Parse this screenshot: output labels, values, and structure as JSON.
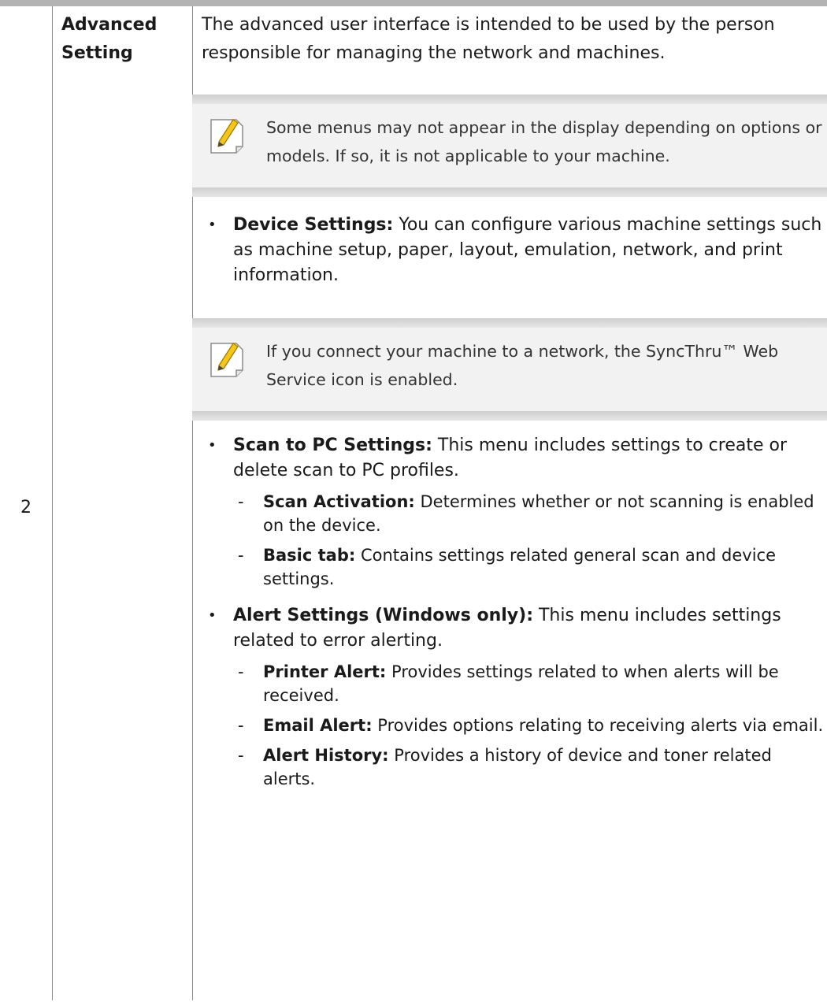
{
  "row_number": "2",
  "label": "Advanced Setting",
  "intro": "The advanced user interface is intended to be used by the person responsible for managing the network and machines.",
  "note1": "Some menus may not appear in the display depending on options or models. If so, it is not applicable to your machine.",
  "device_settings": {
    "title": "Device Settings:",
    "text": " You can configure various machine settings such as machine setup, paper, layout, emulation, network, and print information."
  },
  "note2": "If you connect your machine to a network, the SyncThru™ Web Service icon is enabled.",
  "scan_to_pc": {
    "title": "Scan to PC Settings:",
    "text": " This menu includes settings to create or delete scan to PC profiles.",
    "items": [
      {
        "title": "Scan Activation:",
        "text": " Determines whether or not scanning is enabled on the device."
      },
      {
        "title": "Basic tab:",
        "text": "  Contains settings related general scan and device settings."
      }
    ]
  },
  "alert_settings": {
    "title": "Alert Settings (Windows only):",
    "text": " This menu includes settings related to error alerting.",
    "items": [
      {
        "title": "Printer Alert:",
        "text": " Provides settings related to when alerts will be received."
      },
      {
        "title": "Email Alert:",
        "text": " Provides options relating to receiving alerts via email."
      },
      {
        "title": "Alert History:",
        "text": "  Provides a history of device and toner related alerts."
      }
    ]
  },
  "bullet_char": "•",
  "dash_char": "-"
}
